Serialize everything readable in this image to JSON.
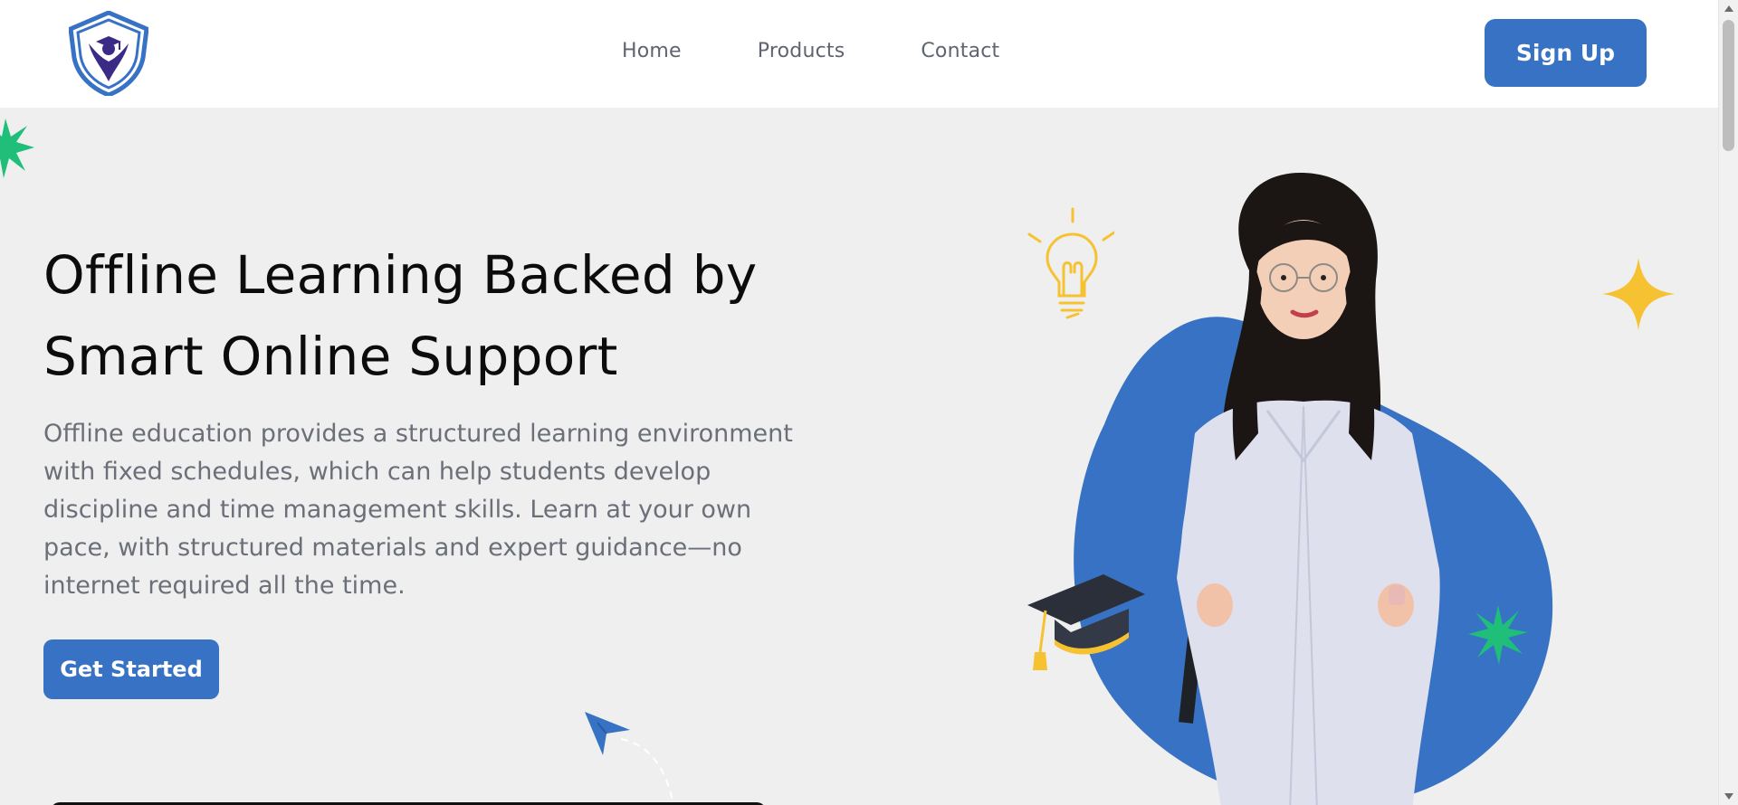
{
  "nav": {
    "logo_icon": "graduate-shield-logo",
    "links": [
      {
        "label": "Home"
      },
      {
        "label": "Products"
      },
      {
        "label": "Contact"
      }
    ],
    "signup_label": "Sign Up"
  },
  "hero": {
    "title_line1": "Offline Learning Backed by",
    "title_line2": "Smart Online Support",
    "description": "Offline education provides a structured learning environment with fixed schedules, which can help students develop discipline and time management skills. Learn at your own pace, with structured materials and expert guidance—no internet required all the time.",
    "cta_label": "Get Started",
    "image_subject": "student-with-backpack",
    "decorations": [
      "green-starburst-icon",
      "lightbulb-icon",
      "yellow-sparkle-icon",
      "graduation-cap-icon",
      "paper-plane-icon"
    ]
  },
  "colors": {
    "primary": "#3872c4",
    "accent_green": "#1fbf7a",
    "accent_yellow": "#f6c232",
    "background": "#efefef",
    "header": "#ffffff",
    "heading_text": "#0c0c0c",
    "body_text": "#6b6f78"
  }
}
